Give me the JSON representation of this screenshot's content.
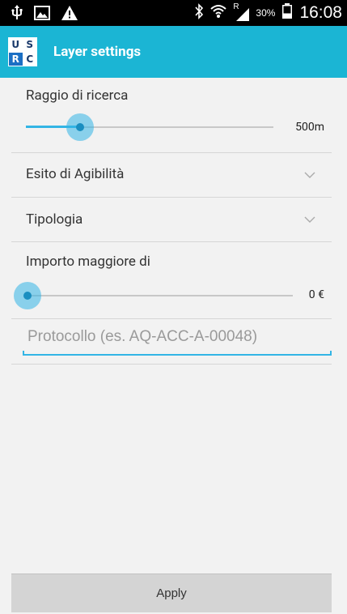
{
  "status_bar": {
    "time": "16:08",
    "battery_text": "30%",
    "network_label": "R"
  },
  "app_bar": {
    "logo_letters": [
      "U",
      "S",
      "R",
      "C"
    ],
    "title": "Layer settings"
  },
  "search_radius": {
    "label": "Raggio di ricerca",
    "value_text": "500m",
    "level": 0.22
  },
  "agibility": {
    "label": "Esito di Agibilità"
  },
  "typology": {
    "label": "Tipologia"
  },
  "amount": {
    "label": "Importo maggiore di",
    "value_text": "0 €",
    "level": 0.0
  },
  "protocol_input": {
    "placeholder": "Protocollo (es. AQ-ACC-A-00048)",
    "value": ""
  },
  "apply_button": {
    "label": "Apply"
  },
  "colors": {
    "status_bar": "#000000",
    "app_bar": "#1bb5d4",
    "accent": "#33b5e5",
    "background": "#f2f2f2",
    "button": "#d4d4d4"
  },
  "icons": [
    "usb-icon",
    "image-icon",
    "warning-icon",
    "bluetooth-icon",
    "wifi-icon",
    "signal-icon",
    "battery-icon",
    "chevron-down-icon"
  ]
}
